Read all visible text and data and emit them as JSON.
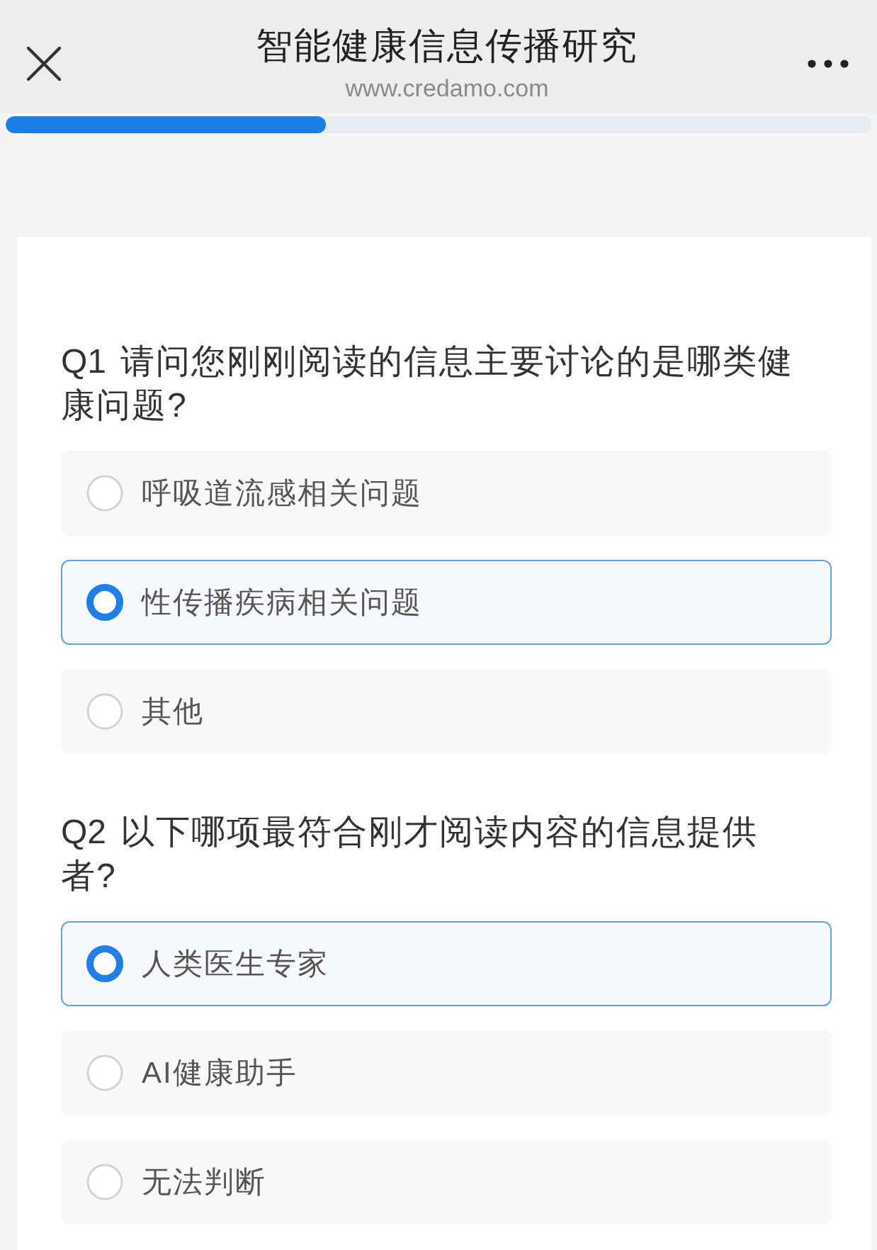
{
  "header": {
    "title": "智能健康信息传播研究",
    "subtitle": "www.credamo.com"
  },
  "progress": {
    "level": 0.37
  },
  "questions": [
    {
      "number": "Q1",
      "text": "请问您刚刚阅读的信息主要讨论的是哪类健康问题?",
      "options": [
        {
          "label": "呼吸道流感相关问题",
          "selected": false
        },
        {
          "label": "性传播疾病相关问题",
          "selected": true
        },
        {
          "label": "其他",
          "selected": false
        }
      ]
    },
    {
      "number": "Q2",
      "text": "以下哪项最符合刚才阅读内容的信息提供者?",
      "options": [
        {
          "label": "人类医生专家",
          "selected": true
        },
        {
          "label": "AI健康助手",
          "selected": false
        },
        {
          "label": "无法判断",
          "selected": false
        }
      ]
    }
  ]
}
